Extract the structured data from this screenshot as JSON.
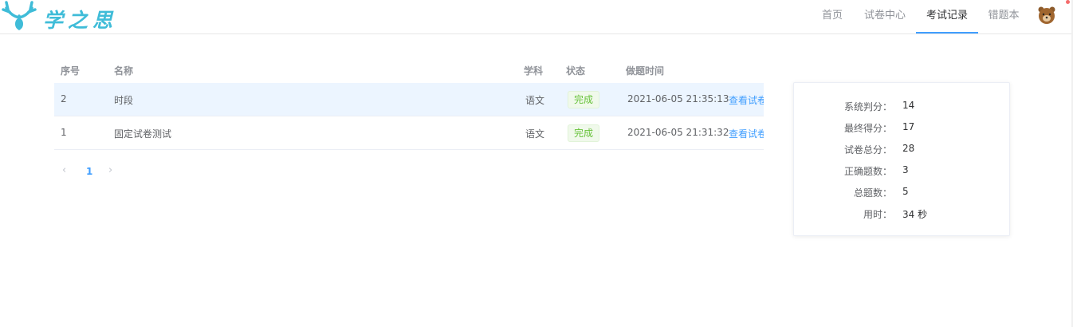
{
  "header": {
    "logo_text": "学之思",
    "nav": [
      "首页",
      "试卷中心",
      "考试记录",
      "错题本"
    ],
    "active_nav": "考试记录"
  },
  "table": {
    "columns": [
      "序号",
      "名称",
      "学科",
      "状态",
      "做题时间"
    ],
    "rows": [
      {
        "index": "2",
        "name": "时段",
        "subject": "语文",
        "status": "完成",
        "time": "2021-06-05 21:35:13",
        "action": "查看试卷"
      },
      {
        "index": "1",
        "name": "固定试卷测试",
        "subject": "语文",
        "status": "完成",
        "time": "2021-06-05 21:31:32",
        "action": "查看试卷"
      }
    ]
  },
  "pagination": {
    "prev": "‹",
    "current": "1",
    "next": "›"
  },
  "stats": {
    "items": [
      {
        "label": "系统判分：",
        "value": "14"
      },
      {
        "label": "最终得分：",
        "value": "17"
      },
      {
        "label": "试卷总分：",
        "value": "28"
      },
      {
        "label": "正确题数：",
        "value": "3"
      },
      {
        "label": "总题数：",
        "value": "5"
      },
      {
        "label": "用时：",
        "value": "34 秒"
      }
    ]
  },
  "colors": {
    "accent": "#409eff",
    "success": "#67c23a",
    "logo": "#3fbcd8"
  }
}
